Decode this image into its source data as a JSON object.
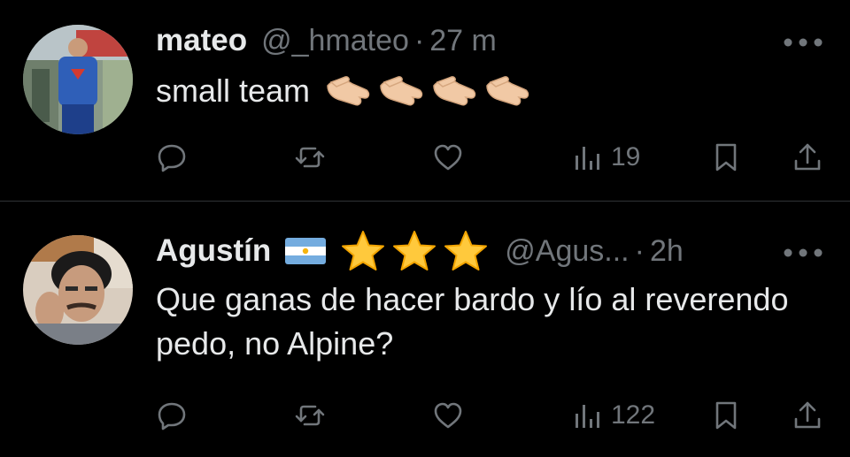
{
  "tweets": [
    {
      "name": "mateo",
      "handle": "@_hmateo",
      "separator": "·",
      "time": "27 m",
      "text": "small team",
      "emoji": [
        "pinching-hand",
        "pinching-hand",
        "pinching-hand",
        "pinching-hand"
      ],
      "views": "19"
    },
    {
      "name": "Agustín",
      "handle": "@Agus...",
      "separator": "·",
      "time": "2h",
      "text": "Que ganas de hacer bardo y lío al reverendo pedo, no Alpine?",
      "flag": "argentina-flag",
      "stars": 3,
      "views": "122"
    }
  ],
  "colors": {
    "background": "#000000",
    "text": "#e7e9ea",
    "muted": "#71767b",
    "divider": "#2f3336"
  }
}
